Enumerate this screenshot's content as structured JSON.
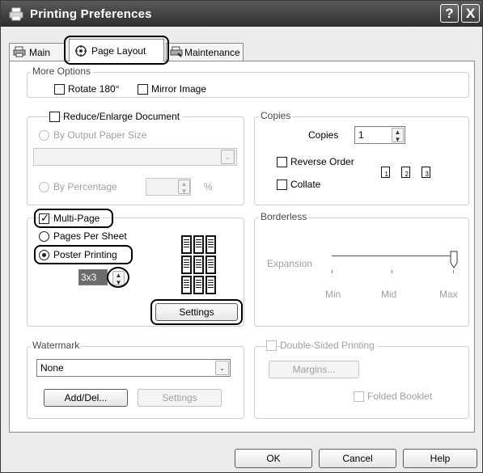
{
  "window": {
    "title": "Printing Preferences",
    "help_label": "?",
    "close_label": "X"
  },
  "tabs": [
    {
      "label": "Main"
    },
    {
      "label": "Page Layout"
    },
    {
      "label": "Maintenance"
    }
  ],
  "more_options": {
    "title": "More Options",
    "rotate": {
      "label": "Rotate 180°",
      "checked": false
    },
    "mirror": {
      "label": "Mirror Image",
      "checked": false
    }
  },
  "reduce_enlarge": {
    "label": "Reduce/Enlarge Document",
    "checked": false,
    "by_output": "By Output Paper Size",
    "by_percentage": "By Percentage",
    "percent_unit": "%"
  },
  "copies": {
    "title": "Copies",
    "copies_label": "Copies",
    "copies_value": "1",
    "reverse_order": "Reverse Order",
    "collate": "Collate",
    "collate_pages": [
      "1",
      "2",
      "3"
    ]
  },
  "multi_page": {
    "label": "Multi-Page",
    "checked": true,
    "pages_per_sheet": "Pages Per Sheet",
    "poster_printing": "Poster Printing",
    "selected": "Poster Printing",
    "poster_size": "3x3",
    "settings_button": "Settings"
  },
  "borderless": {
    "title": "Borderless",
    "expansion": "Expansion",
    "min": "Min",
    "mid": "Mid",
    "max": "Max",
    "level": "Max"
  },
  "watermark": {
    "title": "Watermark",
    "selected": "None",
    "add_del_button": "Add/Del...",
    "settings_button": "Settings"
  },
  "double_sided": {
    "label": "Double-Sided Printing",
    "margins_button": "Margins...",
    "folded_booklet": "Folded Booklet"
  },
  "footer": {
    "ok": "OK",
    "cancel": "Cancel",
    "help": "Help"
  }
}
